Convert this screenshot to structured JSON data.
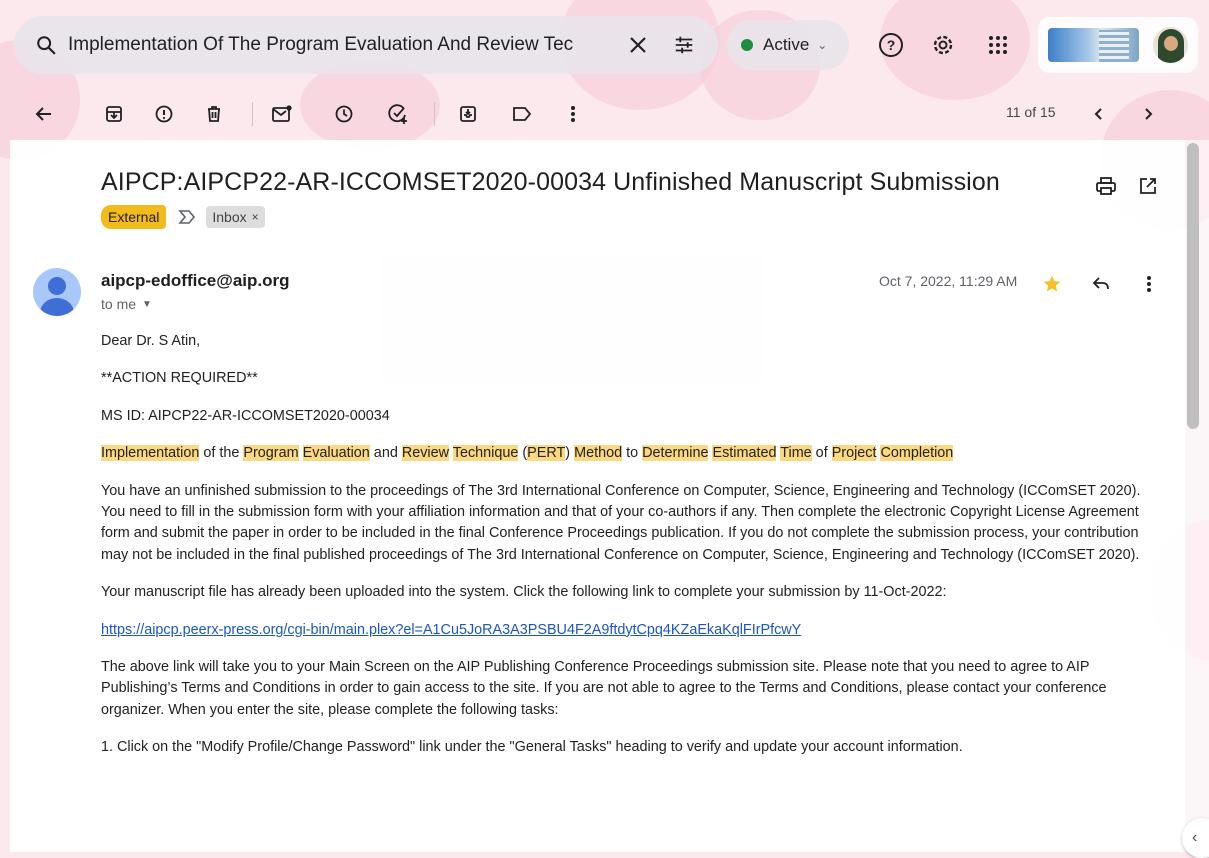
{
  "search": {
    "query": "Implementation Of The Program Evaluation And Review Tec"
  },
  "status": {
    "label": "Active"
  },
  "toolbar": {
    "pager": "11 of 15"
  },
  "email": {
    "subject": "AIPCP:AIPCP22-AR-ICCOMSET2020-00034 Unfinished Manuscript Submission",
    "labels": {
      "external": "External",
      "inbox": "Inbox",
      "inbox_remove": "×"
    },
    "sender": "aipcp-edoffice@aip.org",
    "recipient": "to me",
    "date": "Oct 7, 2022, 11:29 AM",
    "greeting": "Dear Dr. S Atin,",
    "action": "**ACTION REQUIRED**",
    "ms_id": "MS ID: AIPCP22-AR-ICCOMSET2020-00034",
    "title_segments": [
      {
        "t": "Implementation",
        "h": true
      },
      {
        "t": " of the ",
        "h": false
      },
      {
        "t": "Program",
        "h": true
      },
      {
        "t": " ",
        "h": false
      },
      {
        "t": "Evaluation",
        "h": true
      },
      {
        "t": " and ",
        "h": false
      },
      {
        "t": "Review",
        "h": true
      },
      {
        "t": " ",
        "h": false
      },
      {
        "t": "Technique",
        "h": true
      },
      {
        "t": " (",
        "h": false
      },
      {
        "t": "PERT",
        "h": true
      },
      {
        "t": ") ",
        "h": false
      },
      {
        "t": "Method",
        "h": true
      },
      {
        "t": " to ",
        "h": false
      },
      {
        "t": "Determine",
        "h": true
      },
      {
        "t": " ",
        "h": false
      },
      {
        "t": "Estimated",
        "h": true
      },
      {
        "t": " ",
        "h": false
      },
      {
        "t": "Time",
        "h": true
      },
      {
        "t": " of ",
        "h": false
      },
      {
        "t": "Project",
        "h": true
      },
      {
        "t": " ",
        "h": false
      },
      {
        "t": "Completion",
        "h": true
      }
    ],
    "para1": "You have an unfinished submission to the proceedings of The 3rd International Conference on Computer, Science, Engineering and Technology (ICComSET 2020). You need to fill in the submission form with your affiliation information and that of your co-authors if any. Then complete the electronic Copyright License Agreement form and submit the paper in order to be included in the final Conference Proceedings publication. If you do not complete the submission process, your contribution may not be included in the final published proceedings of The 3rd International Conference on Computer, Science, Engineering and Technology (ICComSET 2020).",
    "para2": "Your manuscript file has already been uploaded into the system. Click the following link to complete your submission by 11-Oct-2022:",
    "link": "https://aipcp.peerx-press.org/cgi-bin/main.plex?el=A1Cu5JoRA3A3PSBU4F2A9ftdytCpq4KZaEkaKqlFIrPfcwY",
    "para3": "The above link will take you to your Main Screen on the AIP Publishing Conference Proceedings submission site. Please note that you need to agree to AIP Publishing’s Terms and Conditions in order to gain access to the site. If you are not able to agree to the Terms and Conditions, please contact your conference organizer. When you enter the site, please complete the following tasks:",
    "task1": "1. Click on the \"Modify Profile/Change Password\" link under the \"General Tasks\" heading to verify and update your account information."
  },
  "colors": {
    "highlight": "#fcd980",
    "external_chip": "#f2ba1d",
    "link": "#1a56c9",
    "active_dot": "#1e8e3e",
    "star": "#f6c026"
  }
}
